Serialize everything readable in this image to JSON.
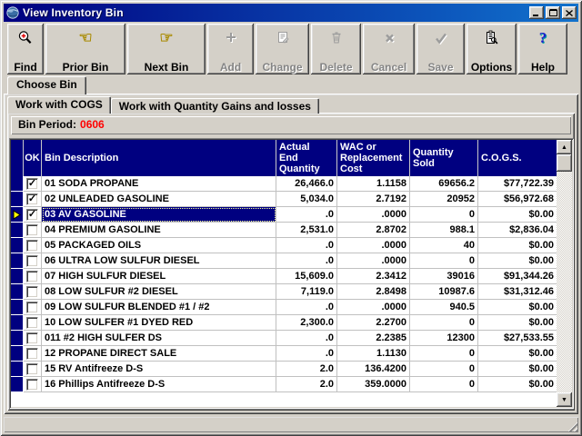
{
  "window": {
    "title": "View Inventory Bin"
  },
  "window_controls": [
    "minimize",
    "maximize",
    "close"
  ],
  "toolbar": {
    "buttons": [
      {
        "name": "find",
        "label": "Find",
        "icon": "find-icon",
        "enabled": true
      },
      {
        "name": "prior-bin",
        "label": "Prior Bin",
        "icon": "hand-left-icon",
        "enabled": true
      },
      {
        "name": "next-bin",
        "label": "Next Bin",
        "icon": "hand-right-icon",
        "enabled": true
      },
      {
        "name": "add",
        "label": "Add",
        "icon": "plus-icon",
        "enabled": false
      },
      {
        "name": "change",
        "label": "Change",
        "icon": "edit-document-icon",
        "enabled": false
      },
      {
        "name": "delete",
        "label": "Delete",
        "icon": "trash-icon",
        "enabled": false
      },
      {
        "name": "cancel",
        "label": "Cancel",
        "icon": "x-icon",
        "enabled": false
      },
      {
        "name": "save",
        "label": "Save",
        "icon": "check-icon",
        "enabled": false
      },
      {
        "name": "options",
        "label": "Options",
        "icon": "options-list-icon",
        "enabled": true
      },
      {
        "name": "help",
        "label": "Help",
        "icon": "question-icon",
        "enabled": true
      }
    ]
  },
  "tabs": {
    "outer_label": "Choose Bin",
    "inner": [
      {
        "label": "Work with COGS",
        "active": true
      },
      {
        "label": "Work with Quantity Gains and losses",
        "active": false
      }
    ]
  },
  "bin_period": {
    "label": "Bin Period:",
    "value": "0606"
  },
  "table": {
    "headers": [
      "",
      "OK",
      "Bin Description",
      "Actual\nEnd\nQuantity",
      "WAC or\nReplacement\nCost",
      "Quantity\nSold",
      "C.O.G.S."
    ],
    "rows": [
      {
        "checked": true,
        "current": false,
        "selected": false,
        "description": "01 SODA PROPANE",
        "actual_end_quantity": "26,466.0",
        "wac_cost": "1.1158",
        "quantity_sold": "69656.2",
        "cogs": "$77,722.39"
      },
      {
        "checked": true,
        "current": false,
        "selected": false,
        "description": "02 UNLEADED GASOLINE",
        "actual_end_quantity": "5,034.0",
        "wac_cost": "2.7192",
        "quantity_sold": "20952",
        "cogs": "$56,972.68"
      },
      {
        "checked": true,
        "current": true,
        "selected": true,
        "description": "03 AV GASOLINE",
        "actual_end_quantity": ".0",
        "wac_cost": ".0000",
        "quantity_sold": "0",
        "cogs": "$0.00"
      },
      {
        "checked": false,
        "current": false,
        "selected": false,
        "description": "04 PREMIUM GASOLINE",
        "actual_end_quantity": "2,531.0",
        "wac_cost": "2.8702",
        "quantity_sold": "988.1",
        "cogs": "$2,836.04"
      },
      {
        "checked": false,
        "current": false,
        "selected": false,
        "description": "05 PACKAGED OILS",
        "actual_end_quantity": ".0",
        "wac_cost": ".0000",
        "quantity_sold": "40",
        "cogs": "$0.00"
      },
      {
        "checked": false,
        "current": false,
        "selected": false,
        "description": "06 ULTRA LOW SULFUR DIESEL",
        "actual_end_quantity": ".0",
        "wac_cost": ".0000",
        "quantity_sold": "0",
        "cogs": "$0.00"
      },
      {
        "checked": false,
        "current": false,
        "selected": false,
        "description": "07 HIGH SULFUR DIESEL",
        "actual_end_quantity": "15,609.0",
        "wac_cost": "2.3412",
        "quantity_sold": "39016",
        "cogs": "$91,344.26"
      },
      {
        "checked": false,
        "current": false,
        "selected": false,
        "description": "08 LOW SULFUR #2 DIESEL",
        "actual_end_quantity": "7,119.0",
        "wac_cost": "2.8498",
        "quantity_sold": "10987.6",
        "cogs": "$31,312.46"
      },
      {
        "checked": false,
        "current": false,
        "selected": false,
        "description": "09 LOW SULFUR BLENDED #1 / #2",
        "actual_end_quantity": ".0",
        "wac_cost": ".0000",
        "quantity_sold": "940.5",
        "cogs": "$0.00"
      },
      {
        "checked": false,
        "current": false,
        "selected": false,
        "description": "10 LOW SULFER #1 DYED RED",
        "actual_end_quantity": "2,300.0",
        "wac_cost": "2.2700",
        "quantity_sold": "0",
        "cogs": "$0.00"
      },
      {
        "checked": false,
        "current": false,
        "selected": false,
        "description": "011 #2 HIGH SULFER DS",
        "actual_end_quantity": ".0",
        "wac_cost": "2.2385",
        "quantity_sold": "12300",
        "cogs": "$27,533.55"
      },
      {
        "checked": false,
        "current": false,
        "selected": false,
        "description": "12 PROPANE DIRECT SALE",
        "actual_end_quantity": ".0",
        "wac_cost": "1.1130",
        "quantity_sold": "0",
        "cogs": "$0.00"
      },
      {
        "checked": false,
        "current": false,
        "selected": false,
        "description": "15 RV Antifreeze D-S",
        "actual_end_quantity": "2.0",
        "wac_cost": "136.4200",
        "quantity_sold": "0",
        "cogs": "$0.00"
      },
      {
        "checked": false,
        "current": false,
        "selected": false,
        "description": "16 Phillips Antifreeze D-S",
        "actual_end_quantity": "2.0",
        "wac_cost": "359.0000",
        "quantity_sold": "0",
        "cogs": "$0.00"
      }
    ]
  },
  "scrollbar": {
    "up_glyph": "▲",
    "down_glyph": "▼"
  },
  "colors": {
    "titlebar_start": "#000080",
    "titlebar_end": "#1272cc",
    "header_bg": "#000080",
    "selected_bg": "#000080",
    "bin_period_value": "#ff0000",
    "row_marker": "#ffff00",
    "window_face": "#d4d0c8"
  }
}
